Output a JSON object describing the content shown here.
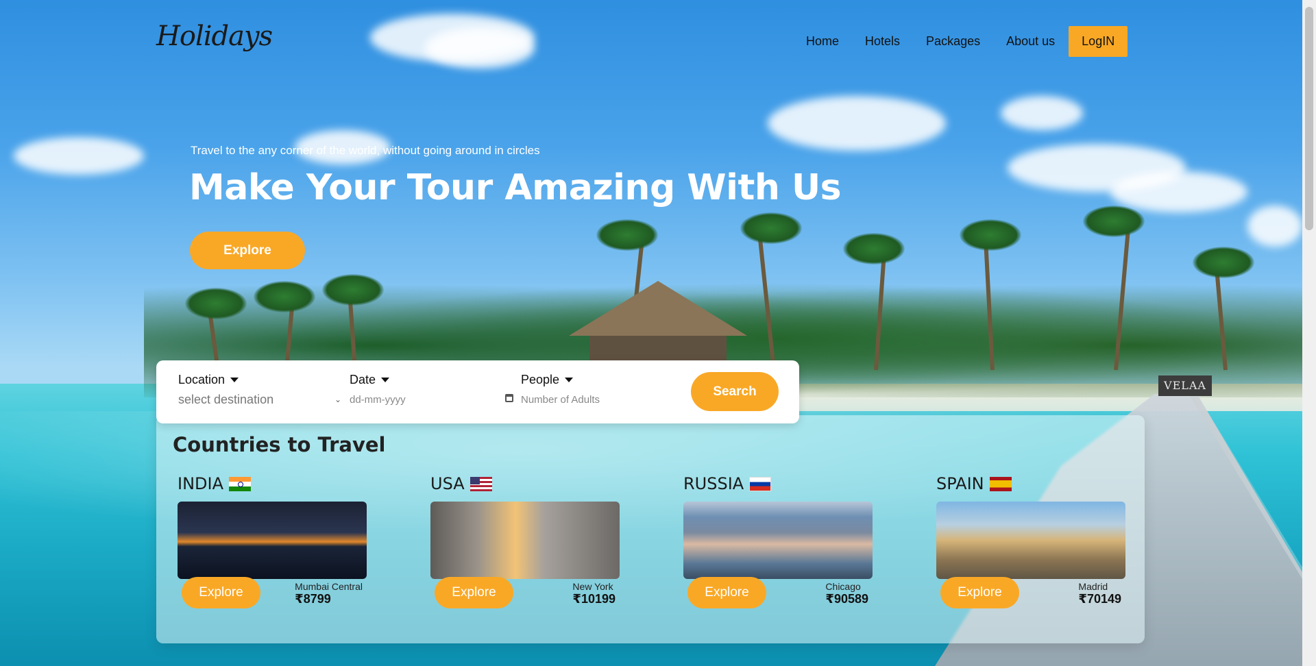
{
  "brand": {
    "logo_text": "Holidays"
  },
  "nav": {
    "items": [
      "Home",
      "Hotels",
      "Packages",
      "About us"
    ],
    "login_label": "LogIN"
  },
  "hero": {
    "subtitle": "Travel to the any corner of the world, without going around in circles",
    "title": "Make Your Tour Amazing With Us",
    "button_label": "Explore"
  },
  "search": {
    "location_label": "Location",
    "location_value": "select destination",
    "date_label": "Date",
    "date_placeholder": "dd-mm-yyyy",
    "people_label": "People",
    "people_placeholder": "Number of Adults",
    "button_label": "Search"
  },
  "scene": {
    "sign_text": "VELAA"
  },
  "countries": {
    "title": "Countries to Travel",
    "items": [
      {
        "name": "INDIA",
        "button": "Explore",
        "city": "Mumbai Central",
        "price": "₹8799"
      },
      {
        "name": "USA",
        "button": "Explore",
        "city": "New York",
        "price": "₹10199"
      },
      {
        "name": "RUSSIA",
        "button": "Explore",
        "city": "Chicago",
        "price": "₹90589"
      },
      {
        "name": "SPAIN",
        "button": "Explore",
        "city": "Madrid",
        "price": "₹70149"
      }
    ]
  },
  "colors": {
    "accent": "#f9a826"
  }
}
